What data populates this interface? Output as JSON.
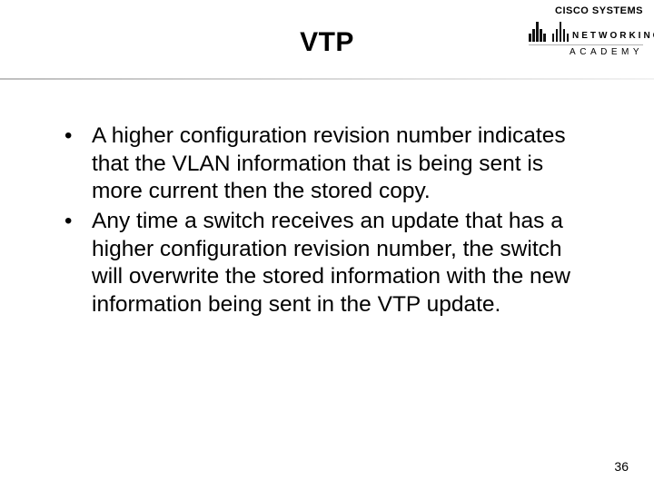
{
  "title": "VTP",
  "logo": {
    "company": "CISCO SYSTEMS",
    "line1": "NETWORKING",
    "line2": "ACADEMY"
  },
  "bullets": {
    "item1": "A higher configuration revision number indicates that the VLAN information that is being sent is more current then the stored copy.",
    "item2": "Any time a switch receives an update that has a higher configuration revision number, the switch will overwrite the stored information with the new information being sent in the VTP update."
  },
  "page_number": "36"
}
